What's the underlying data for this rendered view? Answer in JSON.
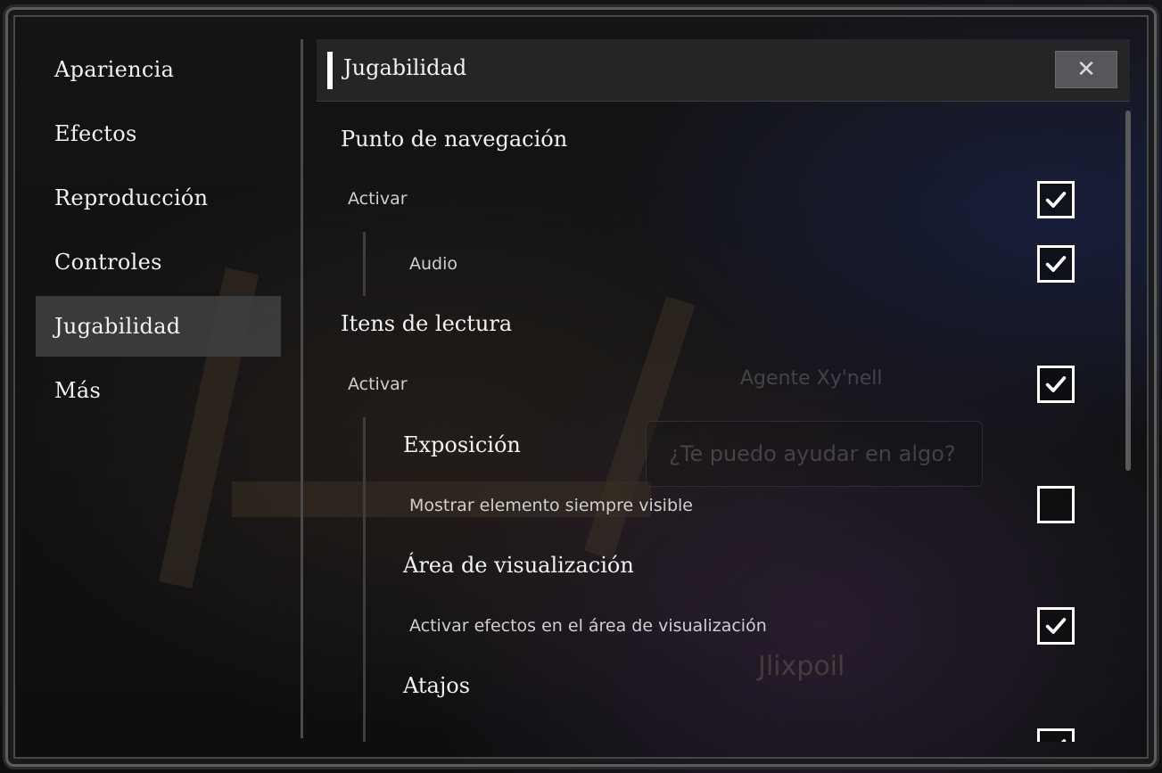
{
  "sidebar": {
    "items": [
      {
        "label": "Apariencia"
      },
      {
        "label": "Efectos"
      },
      {
        "label": "Reproducción"
      },
      {
        "label": "Controles"
      },
      {
        "label": "Jugabilidad",
        "active": true
      },
      {
        "label": "Más"
      }
    ]
  },
  "header": {
    "title": "Jugabilidad",
    "close_label": "✕"
  },
  "background": {
    "npc_name": "Agente Xy'nell",
    "npc_prompt": "¿Te puedo ayudar en algo?",
    "player_name": "Jlixpoil"
  },
  "settings": {
    "nav_point": {
      "title": "Punto de navegación",
      "enable_label": "Activar",
      "enable_checked": true,
      "audio_label": "Audio",
      "audio_checked": true
    },
    "reading_items": {
      "title": "Itens de lectura",
      "enable_label": "Activar",
      "enable_checked": true
    },
    "exposure": {
      "title": "Exposición",
      "always_visible_label": "Mostrar elemento siempre visible",
      "always_visible_checked": false
    },
    "view_area": {
      "title": "Área de visualización",
      "effects_label": "Activar efectos en el área de visualización",
      "effects_checked": true
    },
    "shortcuts": {
      "title": "Atajos",
      "first_checked": true
    }
  },
  "colors": {
    "panel": "#262628",
    "active_item": "#3e3e40",
    "text": "#f2f2f2",
    "checkbox_border": "#ffffff"
  }
}
